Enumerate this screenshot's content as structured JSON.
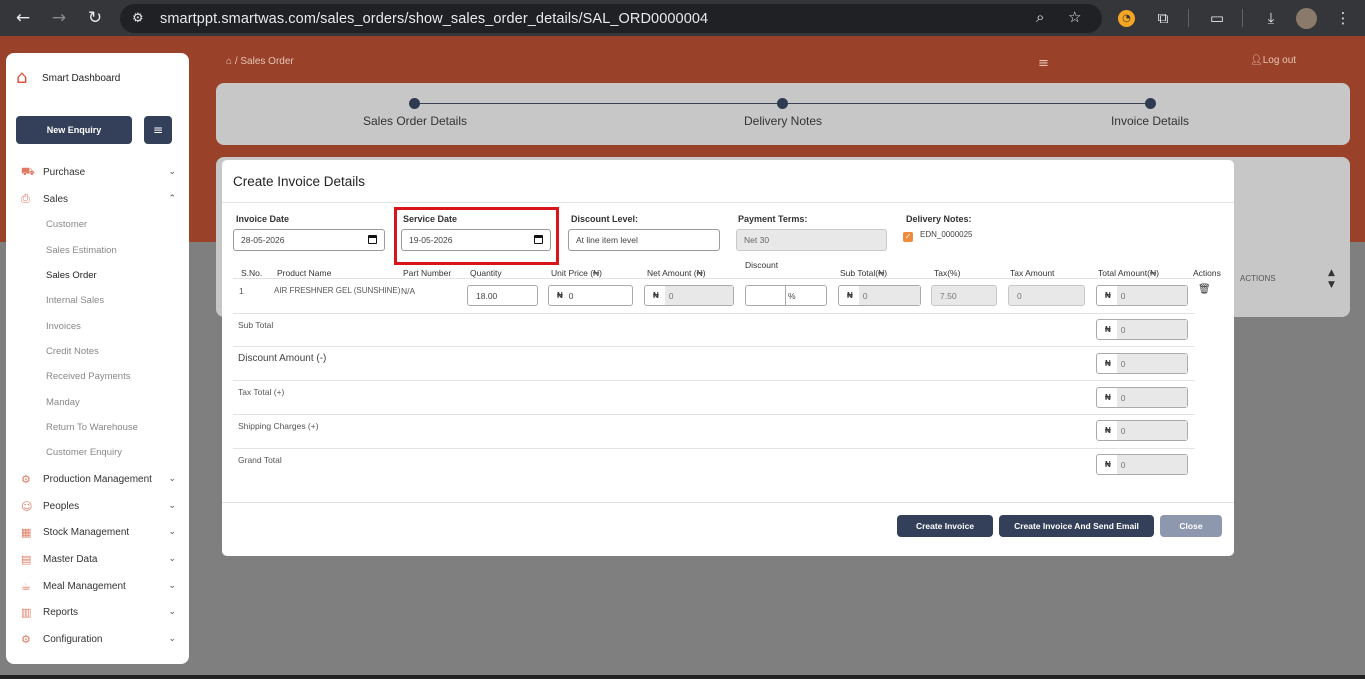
{
  "browser": {
    "url": "smartppt.smartwas.com/sales_orders/show_sales_order_details/SAL_ORD0000004"
  },
  "header": {
    "breadcrumb": "Sales Order",
    "logout": "Log out"
  },
  "sidebar": {
    "brand": "Smart Dashboard",
    "new_enquiry": "New Enquiry",
    "items": [
      {
        "label": "Purchase",
        "icon": "cart-icon"
      },
      {
        "label": "Sales",
        "icon": "sales-icon"
      },
      {
        "label": "Production Management",
        "icon": "production-icon"
      },
      {
        "label": "Peoples",
        "icon": "people-icon"
      },
      {
        "label": "Stock Management",
        "icon": "stock-icon"
      },
      {
        "label": "Master Data",
        "icon": "database-icon"
      },
      {
        "label": "Meal Management",
        "icon": "meal-icon"
      },
      {
        "label": "Reports",
        "icon": "report-icon"
      },
      {
        "label": "Configuration",
        "icon": "config-icon"
      }
    ],
    "sales_sub": [
      "Customer",
      "Sales Estimation",
      "Sales Order",
      "Internal Sales",
      "Invoices",
      "Credit Notes",
      "Received Payments",
      "Manday",
      "Return To Warehouse",
      "Customer Enquiry"
    ]
  },
  "stepper": {
    "steps": [
      "Sales Order Details",
      "Delivery Notes",
      "Invoice Details"
    ]
  },
  "background_table": {
    "actions_header": "ACTIONS"
  },
  "modal": {
    "title": "Create Invoice Details",
    "invoice_date_label": "Invoice Date",
    "invoice_date": "28-05-2026",
    "service_date_label": "Service Date",
    "service_date": "19-05-2026",
    "discount_level_label": "Discount Level:",
    "discount_level": "At line item level",
    "payment_terms_label": "Payment Terms:",
    "payment_terms": "Net 30",
    "delivery_notes_label": "Delivery Notes:",
    "delivery_note": "EDN_0000025",
    "table": {
      "discount_group": "Discount",
      "headers": [
        "S.No.",
        "Product Name",
        "Part Number",
        "Quantity",
        "Unit Price (₦)",
        "Net Amount (₦)",
        "Sub Total(₦)",
        "Tax(%)",
        "Tax Amount",
        "Total Amount(₦)",
        "Actions"
      ],
      "row": {
        "sno": "1",
        "product": "AIR FRESHNER GEL (SUNSHINE)",
        "part": "N/A",
        "quantity": "18.00",
        "unit_price": "0",
        "net_amount": "0",
        "discount_pct": "%",
        "sub_total": "0",
        "tax_pct": "7.50",
        "tax_amount": "0",
        "total": "0"
      }
    },
    "currency": "₦",
    "summary": [
      {
        "label": "Sub Total",
        "value": "0"
      },
      {
        "label": "Discount Amount (-)",
        "value": "0"
      },
      {
        "label": "Tax Total (+)",
        "value": "0"
      },
      {
        "label": "Shipping Charges (+)",
        "value": "0"
      },
      {
        "label": "Grand Total",
        "value": "0"
      }
    ],
    "buttons": {
      "create": "Create Invoice",
      "create_email": "Create Invoice And Send Email",
      "close": "Close"
    }
  }
}
